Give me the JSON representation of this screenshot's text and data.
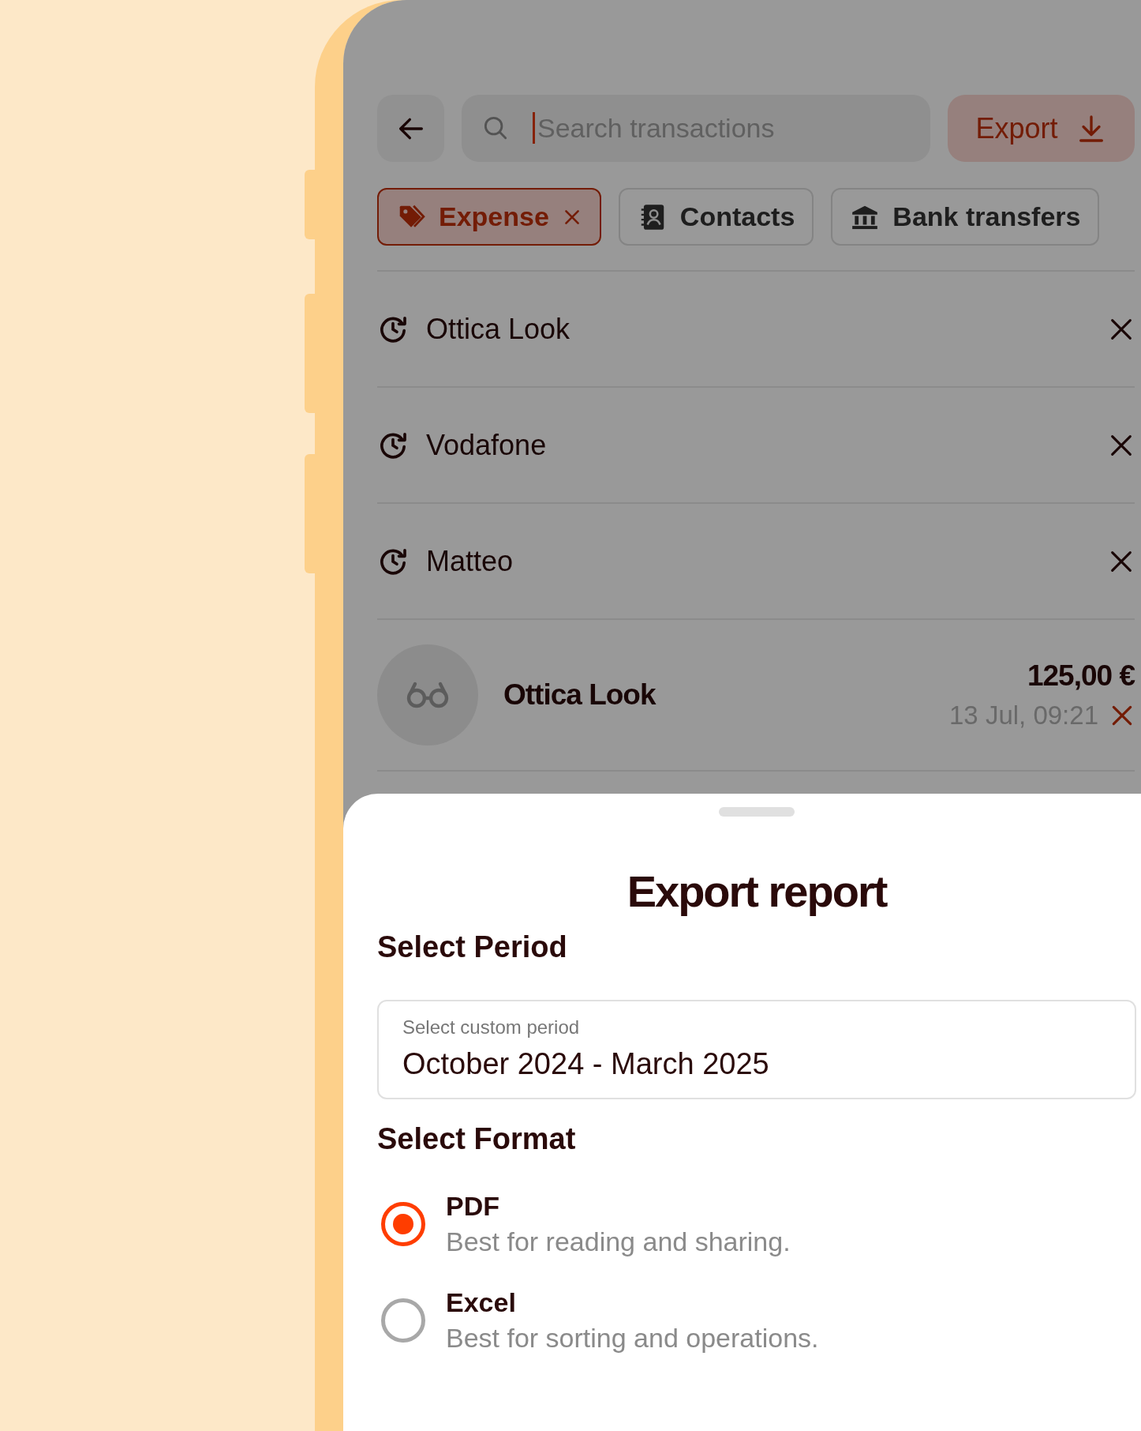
{
  "search": {
    "placeholder": "Search transactions"
  },
  "export_button": {
    "label": "Export"
  },
  "filters": [
    {
      "label": "Expense",
      "selected": true,
      "kind": "tag"
    },
    {
      "label": "Contacts",
      "selected": false,
      "kind": "contacts"
    },
    {
      "label": "Bank transfers",
      "selected": false,
      "kind": "bank"
    }
  ],
  "recent_searches": [
    {
      "label": "Ottica Look"
    },
    {
      "label": "Vodafone"
    },
    {
      "label": "Matteo"
    }
  ],
  "transactions": [
    {
      "name": "Ottica Look",
      "amount": "125,00 €",
      "time": "13 Jul, 09:21"
    }
  ],
  "sheet": {
    "title": "Export report",
    "period_heading": "Select Period",
    "period_field": {
      "label": "Select custom period",
      "value": "October 2024 - March 2025"
    },
    "format_heading": "Select Format",
    "formats": [
      {
        "name": "PDF",
        "description": "Best for reading and sharing.",
        "selected": true
      },
      {
        "name": "Excel",
        "description": "Best for sorting and operations.",
        "selected": false
      }
    ]
  }
}
